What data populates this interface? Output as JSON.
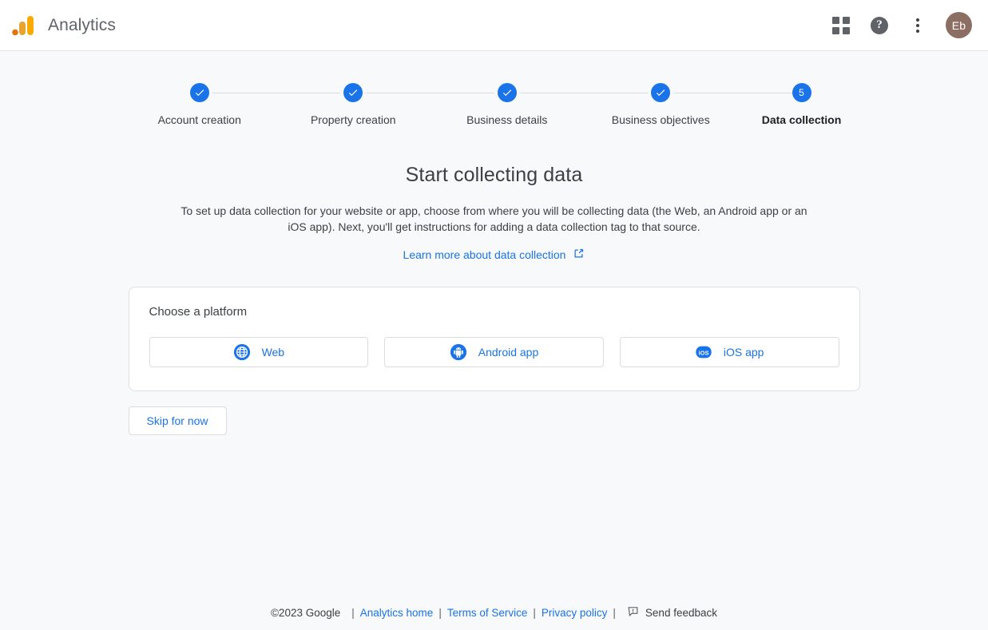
{
  "header": {
    "brand_title": "Analytics",
    "logo_icon": "google-analytics-logo",
    "apps_icon": "apps-grid-icon",
    "help_icon": "help-icon",
    "help_glyph": "?",
    "more_icon": "more-vert-icon",
    "avatar_initials": "Eb",
    "avatar_color": "#8d6e63"
  },
  "stepper": {
    "steps": [
      {
        "label": "Account creation",
        "state": "complete",
        "marker": "check"
      },
      {
        "label": "Property creation",
        "state": "complete",
        "marker": "check"
      },
      {
        "label": "Business details",
        "state": "complete",
        "marker": "check"
      },
      {
        "label": "Business objectives",
        "state": "complete",
        "marker": "check"
      },
      {
        "label": "Data collection",
        "state": "active",
        "marker": "5"
      }
    ],
    "active_color": "#1a73e8",
    "connector_color": "#dadce0"
  },
  "main": {
    "title": "Start collecting data",
    "description": "To set up data collection for your website or app, choose from where you will be collecting data (the Web, an Android app or an iOS app). Next, you'll get instructions for adding a data collection tag to that source.",
    "learn_more": {
      "label": "Learn more about data collection",
      "icon": "external-link-icon",
      "color": "#1a73e8"
    },
    "platform_card": {
      "heading": "Choose a platform",
      "platforms": [
        {
          "label": "Web",
          "icon": "globe-icon"
        },
        {
          "label": "Android app",
          "icon": "android-icon"
        },
        {
          "label": "iOS app",
          "icon": "ios-icon",
          "icon_text": "iOS"
        }
      ]
    },
    "skip_label": "Skip for now"
  },
  "footer": {
    "copyright": "©2023 Google",
    "sep": "|",
    "links": [
      {
        "label": "Analytics home"
      },
      {
        "label": "Terms of Service"
      },
      {
        "label": "Privacy policy"
      }
    ],
    "feedback_label": "Send feedback",
    "feedback_icon": "feedback-icon"
  }
}
